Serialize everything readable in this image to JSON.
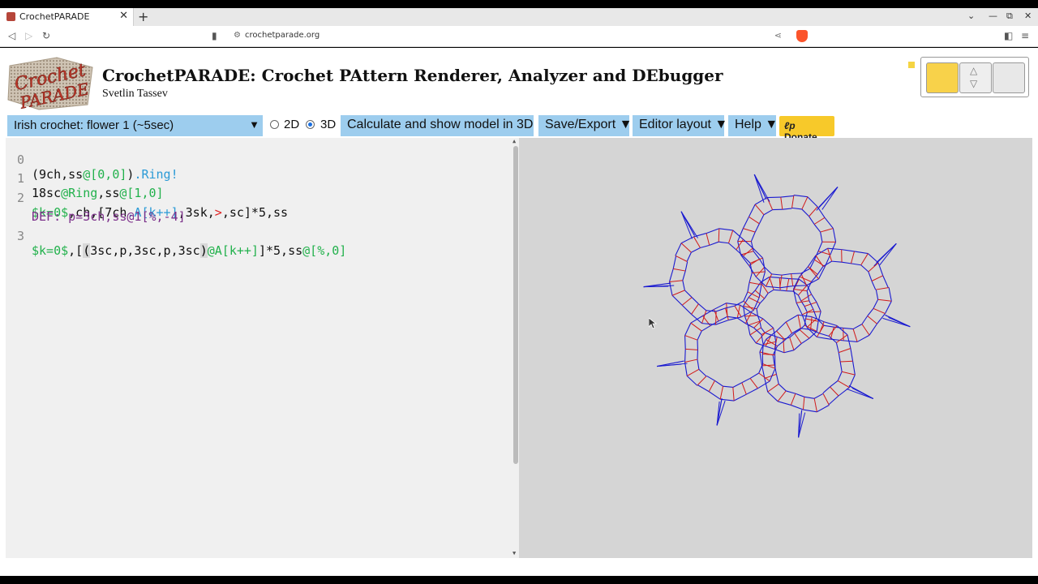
{
  "browser": {
    "tab_title": "CrochetPARADE",
    "tab_close": "✕",
    "new_tab": "+",
    "url": "crochetparade.org"
  },
  "header": {
    "logo_text_top": "Crochet",
    "logo_text_bottom": "PARADE",
    "title": "CrochetPARADE: Crochet PAttern Renderer, Analyzer and DEbugger",
    "author": "Svetlin Tassev"
  },
  "toolbar": {
    "pattern_select": "Irish crochet: flower 1 (~5sec)",
    "mode_2d": "2D",
    "mode_3d": "3D",
    "selected_mode": "3D",
    "calculate": "Calculate and show model in 3D",
    "save_export": "Save/Export ▼",
    "editor_layout": "Editor layout ▼",
    "help": "Help ▼",
    "donate": "Donate"
  },
  "editor": {
    "line_numbers": [
      "0",
      "1",
      "2",
      "3"
    ],
    "lines": [
      [
        {
          "t": "(9ch,ss",
          "c": "default"
        },
        {
          "t": "@[0,0]",
          "c": "green"
        },
        {
          "t": ")",
          "c": "default"
        },
        {
          "t": ".Ring!",
          "c": "blue"
        }
      ],
      [
        {
          "t": "18sc",
          "c": "default"
        },
        {
          "t": "@Ring",
          "c": "green"
        },
        {
          "t": ",ss",
          "c": "default"
        },
        {
          "t": "@[1,0]",
          "c": "green"
        }
      ],
      [
        {
          "t": "$k=0$",
          "c": "green"
        },
        {
          "t": ",ch,[7ch",
          "c": "default"
        },
        {
          "t": ".A[k++]",
          "c": "blue"
        },
        {
          "t": ",3sk,",
          "c": "default"
        },
        {
          "t": ">",
          "c": "red"
        },
        {
          "t": ",sc]*5,ss",
          "c": "default"
        }
      ],
      [
        {
          "t": "DEF: p=3ch,ss@1[%,-4]",
          "c": "purple"
        }
      ],
      [
        {
          "t": "$k=0$",
          "c": "green"
        },
        {
          "t": ",[",
          "c": "default"
        },
        {
          "t": "(",
          "c": "hl"
        },
        {
          "t": "3sc,p,3sc,p,3sc",
          "c": "default"
        },
        {
          "t": ")",
          "c": "hl"
        },
        {
          "t": "@A[k++]",
          "c": "green"
        },
        {
          "t": "]*5,ss",
          "c": "default"
        },
        {
          "t": "@[%,0]",
          "c": "green"
        }
      ]
    ]
  },
  "colors": {
    "button_blue": "#9dcdee",
    "donate_yellow": "#f7c92a",
    "model_bg": "#d5d5d5",
    "stitch_blue": "#1a1ad0",
    "stitch_red": "#d01a1a"
  }
}
